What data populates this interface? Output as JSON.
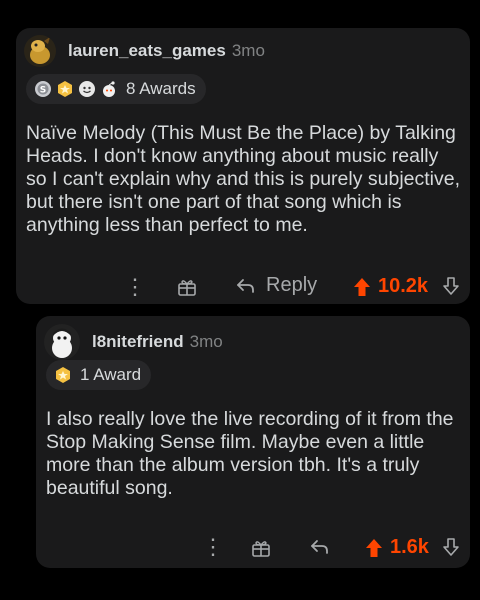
{
  "comments": [
    {
      "username": "lauren_eats_games",
      "age": "3mo",
      "awards_label": "8 Awards",
      "award_icons": [
        "silver-award-icon",
        "gold-award-icon",
        "wholesome-award-icon",
        "helpful-award-icon"
      ],
      "body": "Naïve Melody (This Must Be the Place) by Talking Heads. I don't know anything about music really so I can't explain why and this is purely subjective, but there isn't one part of that song which is anything less than perfect to me.",
      "reply_label": "Reply",
      "vote_count": "10.2k",
      "more_label": "⋮"
    },
    {
      "username": "l8nitefriend",
      "age": "3mo",
      "awards_label": "1 Award",
      "award_icons": [
        "gold-award-icon"
      ],
      "body": "I also really love the live recording of it from the Stop Making Sense film. Maybe even a little more than the album version tbh. It's a truly beautiful song.",
      "vote_count": "1.6k",
      "more_label": "⋮"
    }
  ],
  "colors": {
    "background": "#000000",
    "card": "#1a1a1b",
    "text": "#d7dadc",
    "muted": "#818384",
    "upvote": "#ff4500"
  }
}
